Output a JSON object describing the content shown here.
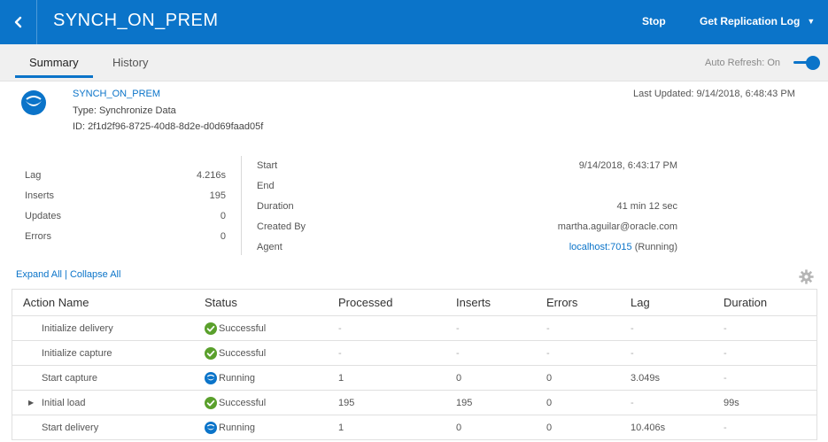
{
  "header": {
    "title": "SYNCH_ON_PREM",
    "stop_label": "Stop",
    "log_label": "Get Replication Log",
    "accent": "#0b74c9"
  },
  "tabs": [
    {
      "label": "Summary",
      "active": true
    },
    {
      "label": "History",
      "active": false
    }
  ],
  "auto_refresh": {
    "label": "Auto Refresh: On",
    "on": true
  },
  "info": {
    "name": "SYNCH_ON_PREM",
    "type": "Type: Synchronize Data",
    "id": "ID: 2f1d2f96-8725-40d8-8d2e-d0d69faad05f",
    "last_updated": "Last Updated: 9/14/2018, 6:48:43 PM",
    "icon": "pipeline-icon"
  },
  "stats": [
    {
      "label": "Lag",
      "value": "4.216s"
    },
    {
      "label": "Inserts",
      "value": "195"
    },
    {
      "label": "Updates",
      "value": "0"
    },
    {
      "label": "Errors",
      "value": "0"
    }
  ],
  "details": {
    "start_label": "Start",
    "start_value": "9/14/2018, 6:43:17 PM",
    "end_label": "End",
    "end_value": "",
    "duration_label": "Duration",
    "duration_value": "41 min 12 sec",
    "created_by_label": "Created By",
    "created_by_value": "martha.aguilar@oracle.com",
    "agent_label": "Agent",
    "agent_link": "localhost:7015",
    "agent_status": " (Running)"
  },
  "controls": {
    "expand_all": "Expand All",
    "separator": " | ",
    "collapse_all": "Collapse All",
    "settings_icon": "gear-icon"
  },
  "table": {
    "columns": [
      "Action Name",
      "Status",
      "Processed",
      "Inserts",
      "Errors",
      "Lag",
      "Duration"
    ],
    "rows": [
      {
        "name": "Initialize delivery",
        "status": "Successful",
        "status_icon": "check-circle-icon",
        "processed": "-",
        "inserts": "-",
        "errors": "-",
        "lag": "-",
        "duration": "-",
        "expandable": false
      },
      {
        "name": "Initialize capture",
        "status": "Successful",
        "status_icon": "check-circle-icon",
        "processed": "-",
        "inserts": "-",
        "errors": "-",
        "lag": "-",
        "duration": "-",
        "expandable": false
      },
      {
        "name": "Start capture",
        "status": "Running",
        "status_icon": "running-icon",
        "processed": "1",
        "inserts": "0",
        "errors": "0",
        "lag": "3.049s",
        "duration": "-",
        "expandable": false
      },
      {
        "name": "Initial load",
        "status": "Successful",
        "status_icon": "check-circle-icon",
        "processed": "195",
        "inserts": "195",
        "errors": "0",
        "lag": "-",
        "duration": "99s",
        "expandable": true
      },
      {
        "name": "Start delivery",
        "status": "Running",
        "status_icon": "running-icon",
        "processed": "1",
        "inserts": "0",
        "errors": "0",
        "lag": "10.406s",
        "duration": "-",
        "expandable": false
      }
    ],
    "success_color": "#5aa02c",
    "running_color": "#0b74c9"
  }
}
